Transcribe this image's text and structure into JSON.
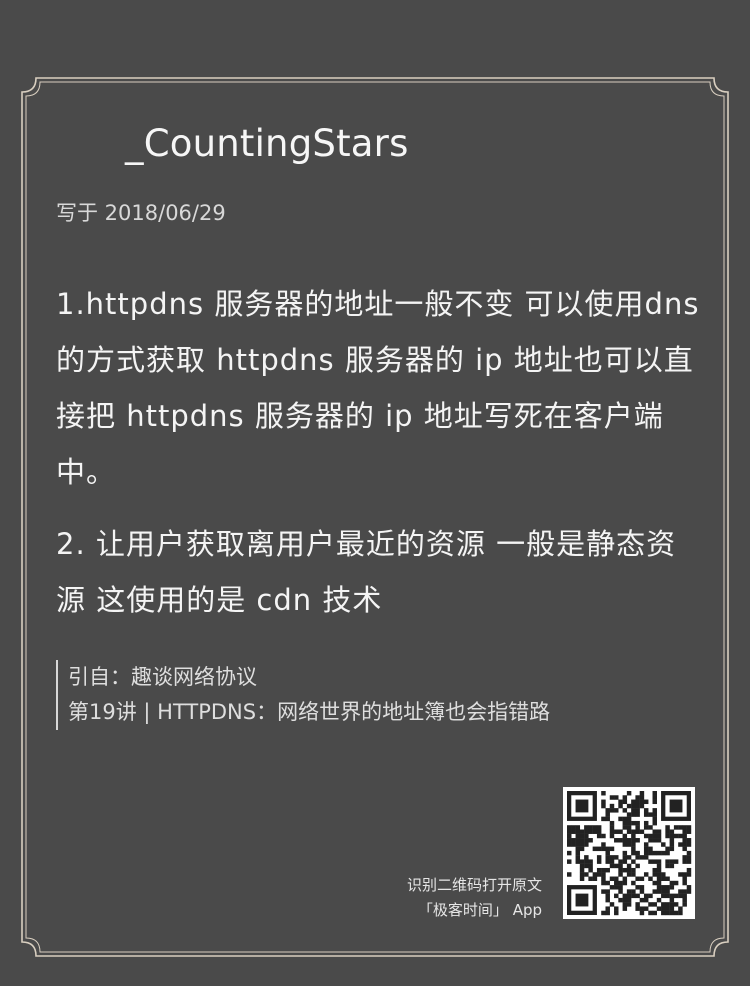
{
  "card": {
    "author": "_CountingStars",
    "date_line": "写于 2018/06/29",
    "paragraphs": [
      "1.httpdns 服务器的地址一般不变 可以使用dns 的方式获取 httpdns 服务器的 ip 地址也可以直接把 httpdns 服务器的 ip 地址写死在客户端中。",
      "2. 让用户获取离用户最近的资源 一般是静态资源 这使用的是 cdn 技术"
    ],
    "citation": {
      "source": "引自：趣谈网络协议",
      "chapter": "第19讲 | HTTPDNS：网络世界的地址簿也会指错路"
    },
    "qr": {
      "caption_line1": "识别二维码打开原文",
      "caption_line2": "「极客时间」 App",
      "icon": "qr-code-icon"
    }
  },
  "colors": {
    "background": "#4a4a4a",
    "frame": "#d9cfc0",
    "text": "#f4f4f4"
  }
}
